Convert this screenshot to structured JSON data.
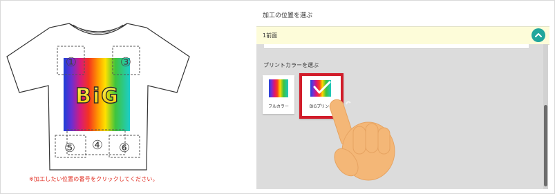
{
  "notice": "※加工したい位置の番号をクリックしてください。",
  "positions": [
    {
      "number": "①"
    },
    {
      "number": "③"
    },
    {
      "number": "④"
    },
    {
      "number": "⑤"
    },
    {
      "number": "⑥"
    }
  ],
  "print_logo": "BiG",
  "panel": {
    "title": "加工の位置を選ぶ",
    "accordion_label": "1前面",
    "accordion_icon": "chevron-up-icon",
    "choose_color_label": "プリントカラーを選ぶ",
    "options": [
      {
        "label": "フルカラー",
        "selected": false
      },
      {
        "label": "BIGプリント",
        "selected": true
      }
    ]
  },
  "colors": {
    "accent": "#21a69c",
    "selected_border": "#d11c2a",
    "notice_text": "#e0281c",
    "accordion_bg": "#fdfcd9",
    "pointer_hand": "#f4b777"
  }
}
